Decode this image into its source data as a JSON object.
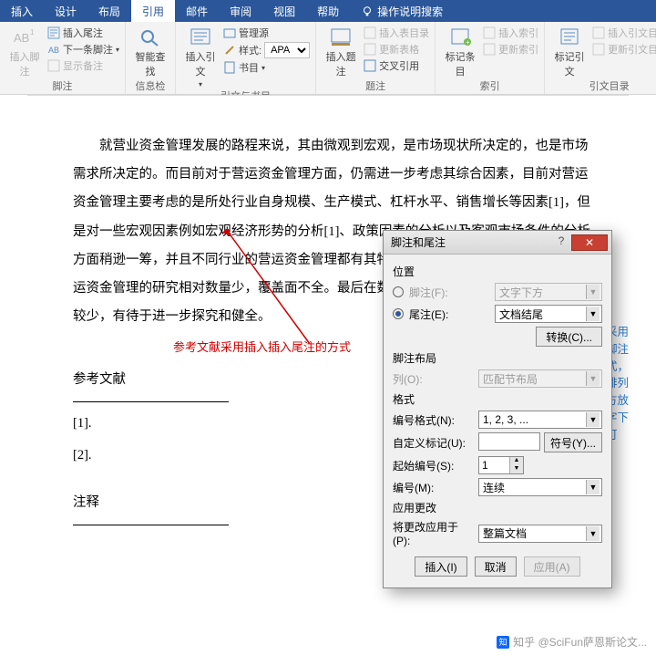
{
  "tabs": {
    "items": [
      "插入",
      "设计",
      "布局",
      "引用",
      "邮件",
      "审阅",
      "视图",
      "帮助"
    ],
    "active_index": 3,
    "tell_me": "操作说明搜索"
  },
  "ribbon": {
    "group1": {
      "main": "插入脚注",
      "main_sub": "AB¹",
      "items": [
        "插入尾注",
        "下一条脚注",
        "显示备注"
      ],
      "label": "脚注"
    },
    "group2": {
      "main": "智能查找",
      "label": "信息检索"
    },
    "group3": {
      "main": "插入引文",
      "manage": "管理源",
      "style_label": "样式:",
      "style_value": "APA",
      "biblio": "书目",
      "label": "引文与书目"
    },
    "group4": {
      "main": "插入题注",
      "items": [
        "插入表目录",
        "更新表格",
        "交叉引用"
      ],
      "label": "题注"
    },
    "group5": {
      "main": "标记条目",
      "items": [
        "插入索引",
        "更新索引"
      ],
      "label": "索引"
    },
    "group6": {
      "main": "标记引文",
      "items": [
        "插入引文目录",
        "更新引文目录"
      ],
      "label": "引文目录"
    }
  },
  "doc": {
    "para": "就营业资金管理发展的路程来说，其由微观到宏观，是市场现状所决定的，也是市场需求所决定的。而目前对于营运资金管理方面，仍需进一步考虑其综合因素，目前对营运资金管理主要考虑的是所处行业自身规模、生产模式、杠杆水平、销售增长等因素[1]，但是对一些宏观因素例如宏观经济形势的分析[1]、政策因素的分析以及客观市场条件的分析方面稍逊一筹，并且不同行业的营运资金管理都有其特殊性，目前从行业角度出发，对营运资金管理的研究相对数量少，覆盖面不全。最后在数字技术在营运资金管理方面的研究较少，有待于进一步探究和健全。",
    "red_note": "参考文献采用插入插入尾注的方式",
    "blue_note": "注释采用插入脚注的方式，然后排列的地方放到文字下方即可",
    "ref_title": "参考文献",
    "refs": [
      "[1].",
      "[2]."
    ],
    "anno_title": "注释"
  },
  "dialog": {
    "title": "脚注和尾注",
    "sec_position": "位置",
    "footnote_label": "脚注(F):",
    "footnote_value": "文字下方",
    "endnote_label": "尾注(E):",
    "endnote_value": "文档结尾",
    "convert_btn": "转换(C)...",
    "sec_layout": "脚注布局",
    "columns_label": "列(O):",
    "columns_value": "匹配节布局",
    "sec_format": "格式",
    "numfmt_label": "编号格式(N):",
    "numfmt_value": "1, 2, 3, ...",
    "custom_label": "自定义标记(U):",
    "custom_value": "",
    "symbol_btn": "符号(Y)...",
    "start_label": "起始编号(S):",
    "start_value": "1",
    "numbering_label": "编号(M):",
    "numbering_value": "连续",
    "sec_apply": "应用更改",
    "apply_label": "将更改应用于(P):",
    "apply_value": "整篇文档",
    "insert_btn": "插入(I)",
    "cancel_btn": "取消",
    "apply_btn": "应用(A)"
  },
  "watermark": "知乎 @SciFun萨恩斯论文..."
}
